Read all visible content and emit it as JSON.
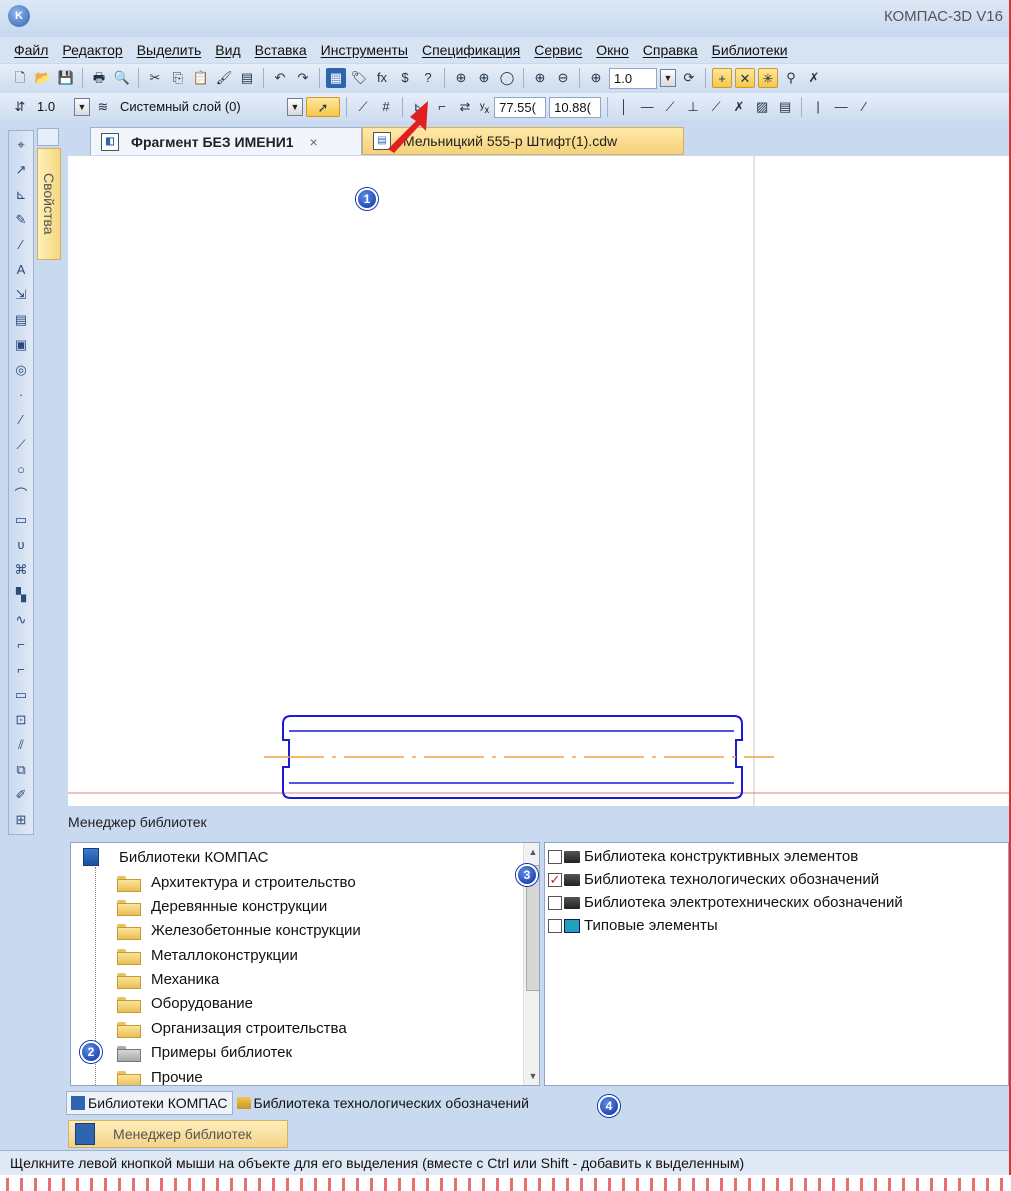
{
  "window": {
    "title": "КОМПАС-3D V16"
  },
  "menu": [
    "Файл",
    "Редактор",
    "Выделить",
    "Вид",
    "Вставка",
    "Инструменты",
    "Спецификация",
    "Сервис",
    "Окно",
    "Справка",
    "Библиотеки"
  ],
  "toolbar1": {
    "zoom_value": "1.0"
  },
  "toolbar2": {
    "scale_value": "1.0",
    "layer_value": "Системный слой (0)",
    "coord_x": "77.55(",
    "coord_y": "10.88("
  },
  "sidebar": {
    "properties_label": "Свойства"
  },
  "doc_tabs": [
    {
      "label": "Фрагмент БЕЗ ИМЕНИ1",
      "close": "×"
    },
    {
      "label": "Мельницкий 555-р Штифт(1).cdw"
    }
  ],
  "library_manager": {
    "title": "Менеджер библиотек",
    "tree_root": "Библиотеки КОМПАС",
    "tree_items": [
      "Архитектура и строительство",
      "Деревянные конструкции",
      "Железобетонные конструкции",
      "Металлоконструкции",
      "Механика",
      "Оборудование",
      "Организация строительства",
      "Примеры библиотек",
      "Прочие"
    ],
    "libraries": [
      {
        "label": "Библиотека конструктивных элементов",
        "checked": false
      },
      {
        "label": "Библиотека технологических обозначений",
        "checked": true
      },
      {
        "label": "Библиотека электротехнических обозначений",
        "checked": false
      },
      {
        "label": "Типовые элементы",
        "checked": false
      }
    ],
    "bottom_tabs": [
      "Библиотеки КОМПАС",
      "Библиотека технологических обозначений"
    ],
    "manager_button": "Менеджер библиотек"
  },
  "badges": [
    "1",
    "2",
    "3",
    "4"
  ],
  "status": "Щелкните левой кнопкой мыши на объекте для его выделения (вместе с Ctrl или Shift - добавить к выделенным)",
  "colors": {
    "accent": "#2e64b0",
    "tab_highlight": "#f6d17a",
    "shape_stroke": "#1a1ad6",
    "axis_line": "#f0a040",
    "arrow": "#e02020"
  }
}
